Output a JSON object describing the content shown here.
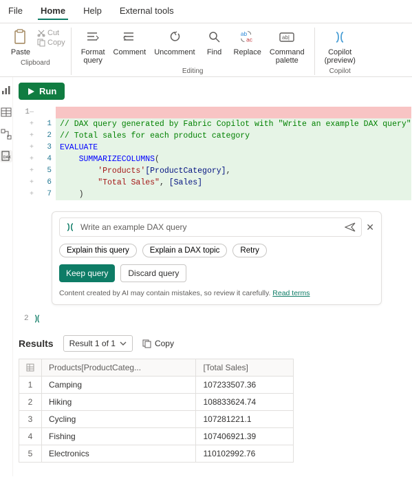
{
  "menubar": {
    "items": [
      "File",
      "Home",
      "Help",
      "External tools"
    ],
    "active_index": 1
  },
  "ribbon": {
    "clipboard": {
      "paste": "Paste",
      "cut": "Cut",
      "copy": "Copy",
      "group": "Clipboard"
    },
    "editing": {
      "format": "Format\nquery",
      "comment": "Comment",
      "uncomment": "Uncomment",
      "find": "Find",
      "replace": "Replace",
      "palette": "Command\npalette",
      "group": "Editing"
    },
    "copilot": {
      "label": "Copilot\n(preview)",
      "group": "Copilot"
    }
  },
  "run_label": "Run",
  "editor": {
    "outer_line": "1",
    "lines": [
      {
        "n": "1",
        "cls": "hl-green",
        "html": "<span class='tok-comment'>// DAX query generated by Fabric Copilot with \"Write an example DAX query\"</span>"
      },
      {
        "n": "2",
        "cls": "hl-green",
        "html": "<span class='tok-comment'>// Total sales for each product category</span>"
      },
      {
        "n": "3",
        "cls": "hl-green",
        "html": "<span class='tok-kw'>EVALUATE</span>"
      },
      {
        "n": "4",
        "cls": "hl-green",
        "html": "    <span class='tok-fn'>SUMMARIZECOLUMNS</span>("
      },
      {
        "n": "5",
        "cls": "hl-green",
        "html": "        <span class='tok-str'>'Products'</span><span class='tok-col'>[ProductCategory]</span>,"
      },
      {
        "n": "6",
        "cls": "hl-green",
        "html": "        <span class='tok-str'>\"Total Sales\"</span>, <span class='tok-col'>[Sales]</span>"
      },
      {
        "n": "7",
        "cls": "hl-green",
        "html": "    )"
      }
    ],
    "line2": "2"
  },
  "copilot": {
    "prompt": "Write an example DAX query",
    "chips": [
      "Explain this query",
      "Explain a DAX topic",
      "Retry"
    ],
    "keep": "Keep query",
    "discard": "Discard query",
    "disclaimer_pre": "Content created by AI may contain mistakes, so review it carefully. ",
    "disclaimer_link": "Read terms"
  },
  "results": {
    "title": "Results",
    "dropdown": "Result 1 of 1",
    "copy": "Copy",
    "columns": [
      "Products[ProductCateg...",
      "[Total Sales]"
    ],
    "rows": [
      {
        "n": "1",
        "c0": "Camping",
        "c1": "107233507.36"
      },
      {
        "n": "2",
        "c0": "Hiking",
        "c1": "108833624.74"
      },
      {
        "n": "3",
        "c0": "Cycling",
        "c1": "107281221.1"
      },
      {
        "n": "4",
        "c0": "Fishing",
        "c1": "107406921.39"
      },
      {
        "n": "5",
        "c0": "Electronics",
        "c1": "110102992.76"
      }
    ]
  }
}
